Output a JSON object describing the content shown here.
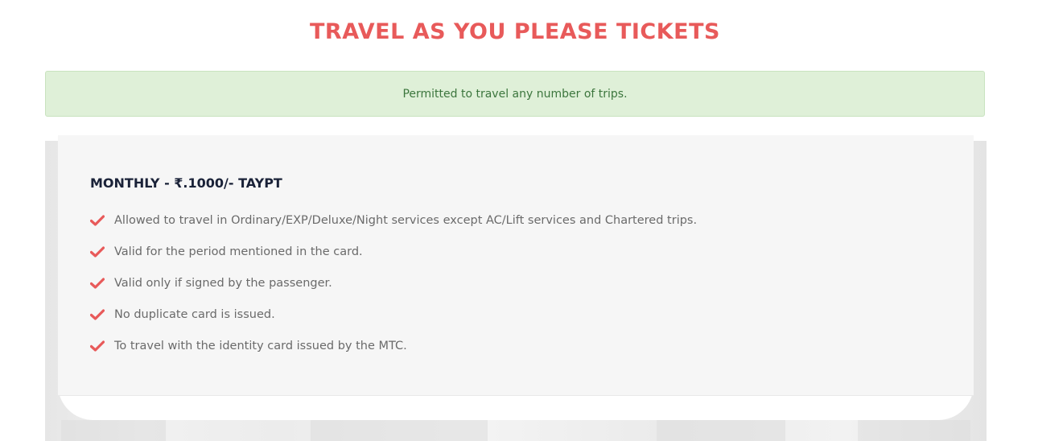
{
  "header": {
    "title": "TRAVEL AS YOU PLEASE TICKETS"
  },
  "notice": {
    "text": "Permitted to travel any number of trips."
  },
  "plan": {
    "title": "MONTHLY - ₹.1000/- TAYPT",
    "features": [
      "Allowed to travel in Ordinary/EXP/Deluxe/Night services except AC/Lift services and Chartered trips.",
      "Valid for the period mentioned in the card.",
      "Valid only if signed by the passenger.",
      "No duplicate card is issued.",
      "To travel with the identity card issued by the MTC."
    ],
    "check_icon": "check-icon"
  },
  "colors": {
    "accent": "#e85a5a",
    "notice_bg": "#dff0d8",
    "notice_text": "#3c763d",
    "card_bg": "#f6f6f6",
    "heading_dark": "#1a2238"
  }
}
